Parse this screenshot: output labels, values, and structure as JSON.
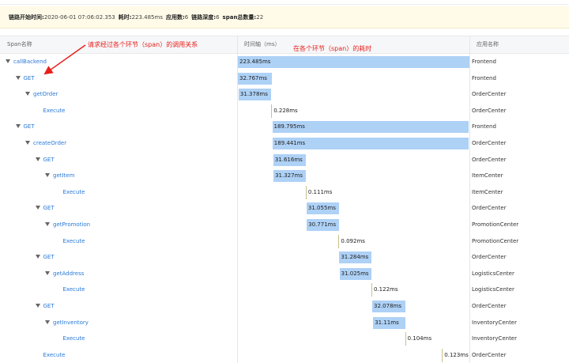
{
  "summary": [
    {
      "key": "链路开始时间:",
      "value": "2020-06-01 07:06:02.353"
    },
    {
      "key": "耗时:",
      "value": "223.485ms"
    },
    {
      "key": "应用数:",
      "value": "6"
    },
    {
      "key": "链路深度:",
      "value": "6"
    },
    {
      "key": "span总数量:",
      "value": "22"
    }
  ],
  "columns": {
    "span": "Span名称",
    "timeline": "时间轴（ms）",
    "app": "应用名称"
  },
  "annotations": {
    "span_note": "请求经过各个环节（span）的调用关系",
    "time_note": "在各个环节（span）的耗时"
  },
  "colors": {
    "bar": "#aed1f6",
    "link": "#2a7ad8",
    "annotation": "#e8201b",
    "summary_bg": "#fffbe8"
  },
  "spans": [
    {
      "name": "callBackend",
      "depth": 0,
      "expandable": true,
      "duration": "223.485ms",
      "duration_ms": 223.485,
      "start_ms": 0,
      "app": "Frontend"
    },
    {
      "name": "GET",
      "depth": 1,
      "expandable": true,
      "duration": "32.767ms",
      "duration_ms": 32.767,
      "start_ms": 0,
      "app": "Frontend"
    },
    {
      "name": "getOrder",
      "depth": 2,
      "expandable": true,
      "duration": "31.378ms",
      "duration_ms": 31.378,
      "start_ms": 0.7,
      "app": "OrderCenter"
    },
    {
      "name": "Execute",
      "depth": 3,
      "expandable": false,
      "duration": "0.228ms",
      "duration_ms": 0.228,
      "start_ms": 32.2,
      "app": "OrderCenter"
    },
    {
      "name": "GET",
      "depth": 1,
      "expandable": true,
      "duration": "189.795ms",
      "duration_ms": 189.795,
      "start_ms": 33.2,
      "app": "Frontend"
    },
    {
      "name": "createOrder",
      "depth": 2,
      "expandable": true,
      "duration": "189.441ms",
      "duration_ms": 189.441,
      "start_ms": 33.4,
      "app": "OrderCenter"
    },
    {
      "name": "GET",
      "depth": 3,
      "expandable": true,
      "duration": "31.616ms",
      "duration_ms": 31.616,
      "start_ms": 34.2,
      "app": "OrderCenter"
    },
    {
      "name": "getItem",
      "depth": 4,
      "expandable": true,
      "duration": "31.327ms",
      "duration_ms": 31.327,
      "start_ms": 34.4,
      "app": "ItemCenter"
    },
    {
      "name": "Execute",
      "depth": 5,
      "expandable": false,
      "duration": "0.111ms",
      "duration_ms": 0.111,
      "start_ms": 65.5,
      "app": "ItemCenter"
    },
    {
      "name": "GET",
      "depth": 3,
      "expandable": true,
      "duration": "31.055ms",
      "duration_ms": 31.055,
      "start_ms": 66.3,
      "app": "OrderCenter"
    },
    {
      "name": "getPromotion",
      "depth": 4,
      "expandable": true,
      "duration": "30.771ms",
      "duration_ms": 30.771,
      "start_ms": 66.5,
      "app": "PromotionCenter"
    },
    {
      "name": "Execute",
      "depth": 5,
      "expandable": false,
      "duration": "0.092ms",
      "duration_ms": 0.092,
      "start_ms": 97.2,
      "app": "PromotionCenter"
    },
    {
      "name": "GET",
      "depth": 3,
      "expandable": true,
      "duration": "31.284ms",
      "duration_ms": 31.284,
      "start_ms": 97.9,
      "app": "OrderCenter"
    },
    {
      "name": "getAddress",
      "depth": 4,
      "expandable": true,
      "duration": "31.025ms",
      "duration_ms": 31.025,
      "start_ms": 98.1,
      "app": "LogisticsCenter"
    },
    {
      "name": "Execute",
      "depth": 5,
      "expandable": false,
      "duration": "0.122ms",
      "duration_ms": 0.122,
      "start_ms": 128.9,
      "app": "LogisticsCenter"
    },
    {
      "name": "GET",
      "depth": 3,
      "expandable": true,
      "duration": "32.078ms",
      "duration_ms": 32.078,
      "start_ms": 129.7,
      "app": "OrderCenter"
    },
    {
      "name": "getInventory",
      "depth": 4,
      "expandable": true,
      "duration": "31.11ms",
      "duration_ms": 31.11,
      "start_ms": 130.6,
      "app": "InventoryCenter"
    },
    {
      "name": "Execute",
      "depth": 5,
      "expandable": false,
      "duration": "0.104ms",
      "duration_ms": 0.104,
      "start_ms": 161.4,
      "app": "InventoryCenter"
    },
    {
      "name": "Execute",
      "depth": 3,
      "expandable": false,
      "duration": "0.123ms",
      "duration_ms": 0.123,
      "start_ms": 197.0,
      "app": "OrderCenter"
    }
  ]
}
